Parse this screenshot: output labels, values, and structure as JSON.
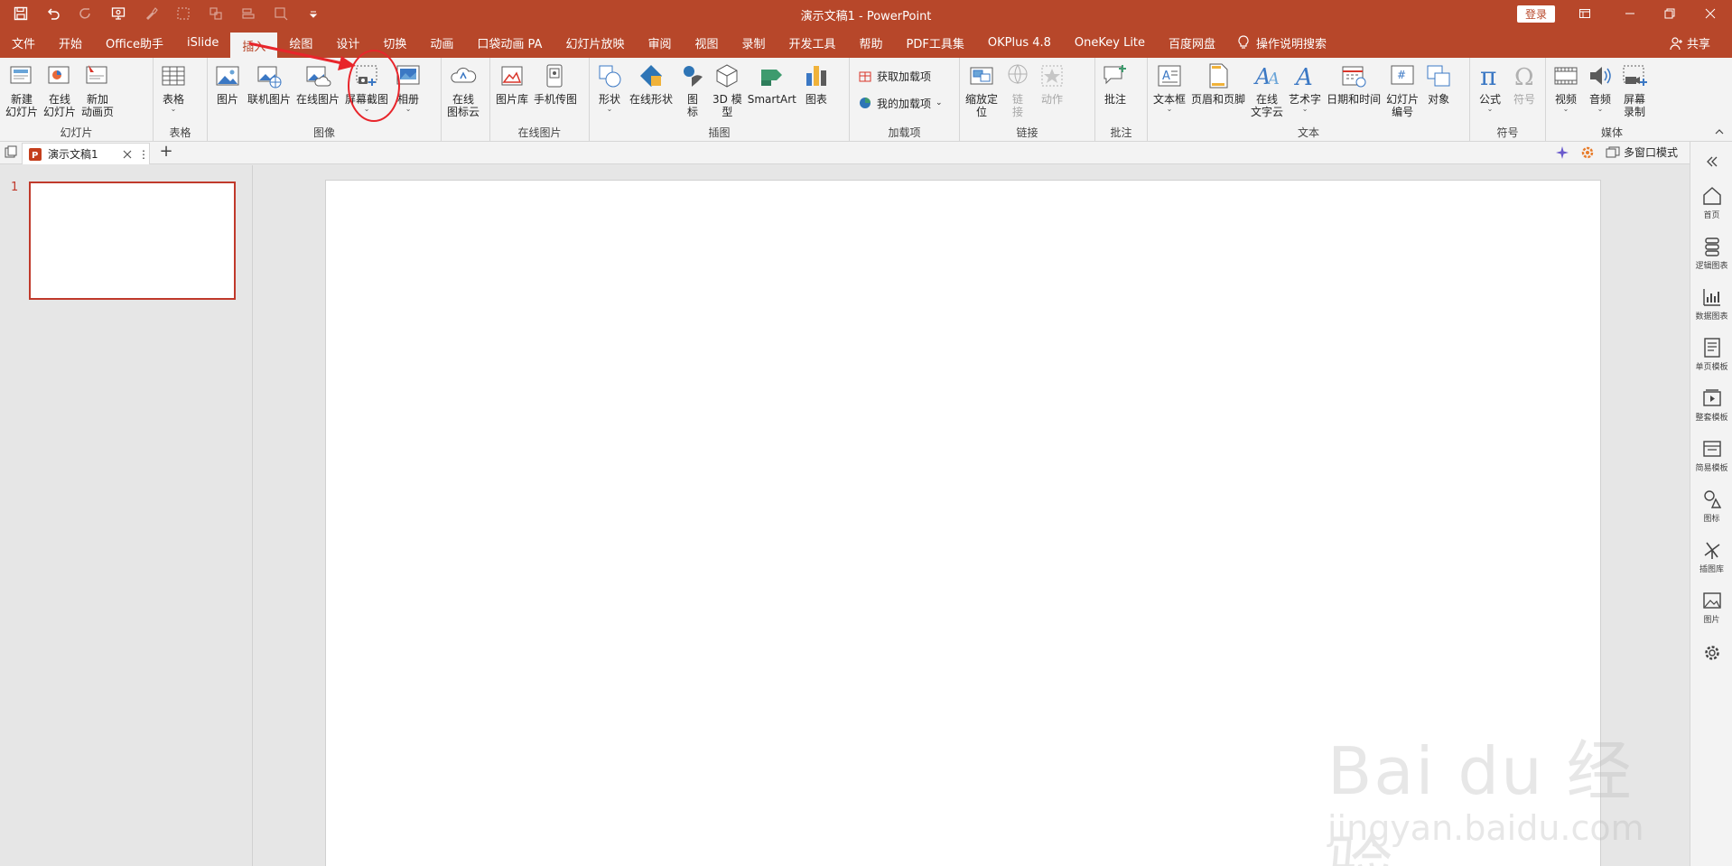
{
  "title_bar": {
    "document_title": "演示文稿1 - PowerPoint",
    "login_label": "登录",
    "qat_icons": [
      "save-icon",
      "undo-icon",
      "redo-icon",
      "present-icon",
      "brush-icon",
      "shape-icon",
      "group-icon",
      "align-icon",
      "sort-icon",
      "more-icon"
    ]
  },
  "tabs": [
    {
      "label": "文件"
    },
    {
      "label": "开始"
    },
    {
      "label": "Office助手"
    },
    {
      "label": "iSlide"
    },
    {
      "label": "插入",
      "active": true
    },
    {
      "label": "绘图"
    },
    {
      "label": "设计"
    },
    {
      "label": "切换"
    },
    {
      "label": "动画"
    },
    {
      "label": "口袋动画 PA"
    },
    {
      "label": "幻灯片放映"
    },
    {
      "label": "审阅"
    },
    {
      "label": "视图"
    },
    {
      "label": "录制"
    },
    {
      "label": "开发工具"
    },
    {
      "label": "帮助"
    },
    {
      "label": "PDF工具集"
    },
    {
      "label": "OKPlus 4.8"
    },
    {
      "label": "OneKey Lite"
    },
    {
      "label": "百度网盘"
    }
  ],
  "tell_me": "操作说明搜索",
  "share": "共享",
  "ribbon": {
    "slides": {
      "label": "幻灯片",
      "new_slide": "新建\n幻灯片",
      "online_slide": "在线\n幻灯片",
      "new_anim_page": "新加\n动画页"
    },
    "tables": {
      "label": "表格",
      "table": "表格"
    },
    "images": {
      "label": "图像",
      "picture": "图片",
      "linked_picture": "联机图片",
      "online_picture": "在线图片",
      "screenshot": "屏幕截图",
      "album": "相册"
    },
    "online_icon": {
      "icon_cloud": "在线\n图标云"
    },
    "online_pictures": {
      "label": "在线图片",
      "gallery": "图片库",
      "phone_pic": "手机传图"
    },
    "illustrations": {
      "label": "插图",
      "shapes": "形状",
      "online_shapes": "在线形状",
      "icons": "图\n标",
      "model3d": "3D 模\n型",
      "smartart": "SmartArt",
      "chart": "图表"
    },
    "addins": {
      "label": "加载项",
      "get_addins": "获取加载项",
      "my_addins": "我的加载项"
    },
    "links": {
      "label": "链接",
      "zoom": "缩放定\n位",
      "link": "链\n接",
      "action": "动作"
    },
    "comments": {
      "label": "批注",
      "comment": "批注"
    },
    "text": {
      "label": "文本",
      "textbox": "文本框",
      "header_footer": "页眉和页脚",
      "online_text_cloud": "在线\n文字云",
      "wordart": "艺术字",
      "date_time": "日期和时间",
      "slide_number": "幻灯片\n编号",
      "object": "对象"
    },
    "symbols": {
      "label": "符号",
      "equation": "公式",
      "symbol": "符号"
    },
    "media": {
      "label": "媒体",
      "video": "视频",
      "audio": "音频",
      "screen_record": "屏幕\n录制"
    }
  },
  "doc_tab": {
    "name": "演示文稿1",
    "multi_window": "多窗口模式"
  },
  "thumbnails": [
    {
      "number": "1"
    }
  ],
  "right_pane": [
    "首页",
    "逻辑图表",
    "数据图表",
    "单页模板",
    "整套模板",
    "简易模板",
    "图标",
    "插图库",
    "图片"
  ],
  "watermark": {
    "text": "Bai du 经验",
    "sub": "jingyan.baidu.com"
  },
  "colors": {
    "accent": "#b7472a",
    "annotation": "#e8252b"
  }
}
